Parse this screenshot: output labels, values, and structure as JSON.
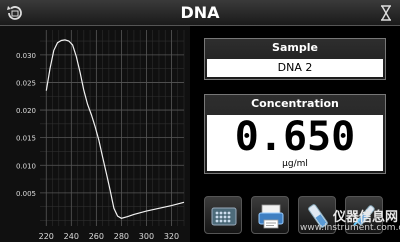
{
  "window": {
    "title": "DNA"
  },
  "sample": {
    "header": "Sample",
    "value": "DNA 2"
  },
  "concentration": {
    "header": "Concentration",
    "value": "0.650",
    "unit": "µg/ml"
  },
  "icons": {
    "refresh": "refresh-icon",
    "hourglass": "hourglass-icon",
    "button_1": "plate-reader-icon",
    "button_2": "print-icon",
    "button_3": "cuvette-icon",
    "button_4": "cuvette-tools-icon"
  },
  "watermark": {
    "main": "仪器信息网",
    "sub": "www.instrument.com.cn"
  },
  "chart_data": {
    "type": "line",
    "title": "",
    "xlabel": "",
    "ylabel": "",
    "x_ticks": [
      "220",
      "240",
      "260",
      "280",
      "300",
      "320"
    ],
    "y_ticks": [
      "0.030",
      "0.025",
      "0.020",
      "0.015",
      "0.010",
      "0.005"
    ],
    "xlim": [
      215,
      330
    ],
    "ylim": [
      -0.001,
      0.0345
    ],
    "grid": true,
    "series": [
      {
        "x": [
          220,
          223,
          226,
          229,
          232,
          235,
          238,
          241,
          244,
          247,
          250,
          253,
          256,
          259,
          262,
          265,
          268,
          271,
          274,
          277,
          280,
          285,
          290,
          300,
          310,
          320,
          330
        ],
        "y": [
          0.0235,
          0.0275,
          0.0308,
          0.0322,
          0.0326,
          0.0327,
          0.0325,
          0.0318,
          0.0297,
          0.0268,
          0.0236,
          0.021,
          0.0192,
          0.017,
          0.0145,
          0.0115,
          0.0085,
          0.0055,
          0.0022,
          0.0008,
          0.0004,
          0.0007,
          0.0011,
          0.0017,
          0.0022,
          0.0027,
          0.0033
        ]
      }
    ]
  }
}
